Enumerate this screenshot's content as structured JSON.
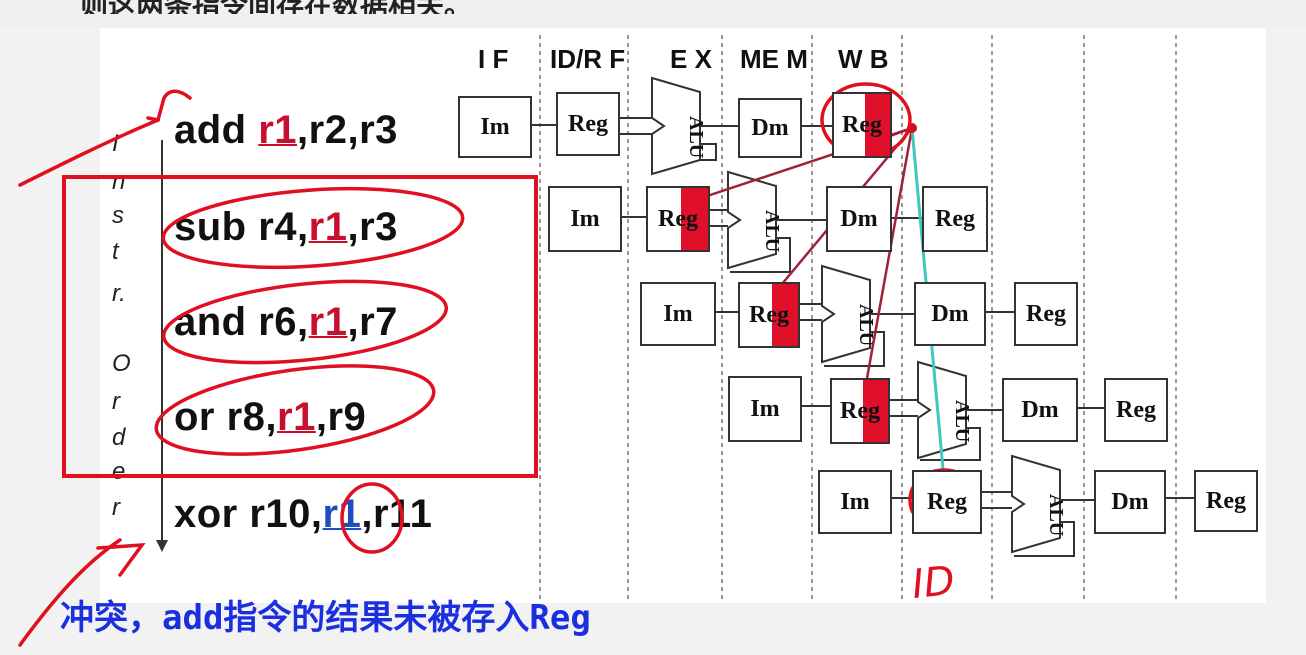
{
  "top_text": "则这两条指令间存在数据相关。",
  "stages": [
    "I F",
    "ID/R F",
    "E X",
    "ME M",
    "W B"
  ],
  "axis_label": [
    "I",
    "n",
    "s",
    "t",
    "r.",
    "",
    "O",
    "r",
    "d",
    "e",
    "r"
  ],
  "instructions": [
    {
      "pre": "add ",
      "reg": "r1",
      "post": ",r2,r3"
    },
    {
      "pre": "sub r4,",
      "reg": "r1",
      "post": ",r3"
    },
    {
      "pre": "and r6,",
      "reg": "r1",
      "post": ",r7"
    },
    {
      "pre": "or   r8,",
      "reg": "r1",
      "post": ",r9"
    },
    {
      "pre": "xor r10,",
      "reg": "r1",
      "post": ",r11"
    }
  ],
  "units": {
    "im": "Im",
    "reg": "Reg",
    "alu": "ALU",
    "dm": "Dm"
  },
  "annotation_id": "ID",
  "caption": "冲突，add指令的结果未被存入Reg",
  "colors": {
    "hazard": "#e01020",
    "highlight_reg": "#e0102a",
    "caption": "#1a2fe0",
    "forward_line": "#40c8c0"
  }
}
